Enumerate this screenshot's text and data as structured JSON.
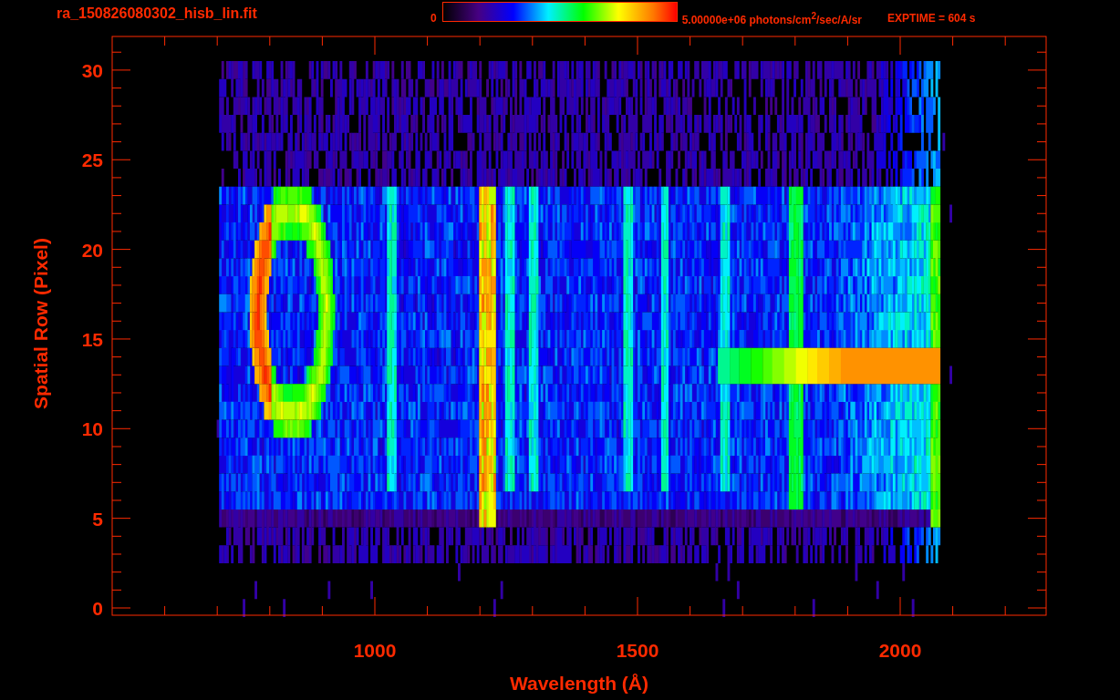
{
  "header": {
    "filename": "ra_150826080302_hisb_lin.fit",
    "colorbar": {
      "min_label": "0",
      "max_label": "5.00000e+06 photons/cm$^{2}$/sec/A/sr"
    },
    "exptime": "EXPTIME = 604 s"
  },
  "plot": {
    "x_axis": {
      "title": "Wavelength (Å)",
      "ticks": [
        "1000",
        "1500",
        "2000"
      ]
    },
    "y_axis": {
      "title": "Spatial Row (Pixel)",
      "ticks": [
        "30",
        "25",
        "20",
        "15",
        "10",
        "5",
        "0"
      ]
    }
  }
}
